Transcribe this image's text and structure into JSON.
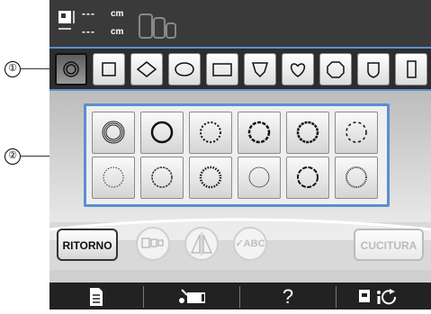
{
  "callouts": {
    "one": "①",
    "two": "②"
  },
  "size_bar": {
    "height_value": "---",
    "height_unit": "cm",
    "width_value": "---",
    "width_unit": "cm"
  },
  "shapes": [
    {
      "name": "circle-double-shape"
    },
    {
      "name": "square-shape"
    },
    {
      "name": "diamond-shape"
    },
    {
      "name": "ellipse-shape"
    },
    {
      "name": "rectangle-shape"
    },
    {
      "name": "shield-shape"
    },
    {
      "name": "heart-shape"
    },
    {
      "name": "octagon-shape"
    },
    {
      "name": "badge-shape"
    },
    {
      "name": "tall-rectangle-shape"
    }
  ],
  "stitches": [
    {
      "style": "triple"
    },
    {
      "style": "bold"
    },
    {
      "style": "dotted"
    },
    {
      "style": "satin-dot"
    },
    {
      "style": "zigzag"
    },
    {
      "style": "dashed"
    },
    {
      "style": "scallop"
    },
    {
      "style": "wave"
    },
    {
      "style": "candle"
    },
    {
      "style": "thin"
    },
    {
      "style": "cross"
    },
    {
      "style": "fine-dot"
    }
  ],
  "buttons": {
    "back_label": "RITORNO",
    "sew_label": "CUCITURA",
    "abc_label": "✓ABC"
  },
  "status": {
    "help_label": "?"
  },
  "colors": {
    "accent_blue": "#5a8fd0",
    "top_bar": "#3a3a3a",
    "status_bar": "#222222"
  }
}
